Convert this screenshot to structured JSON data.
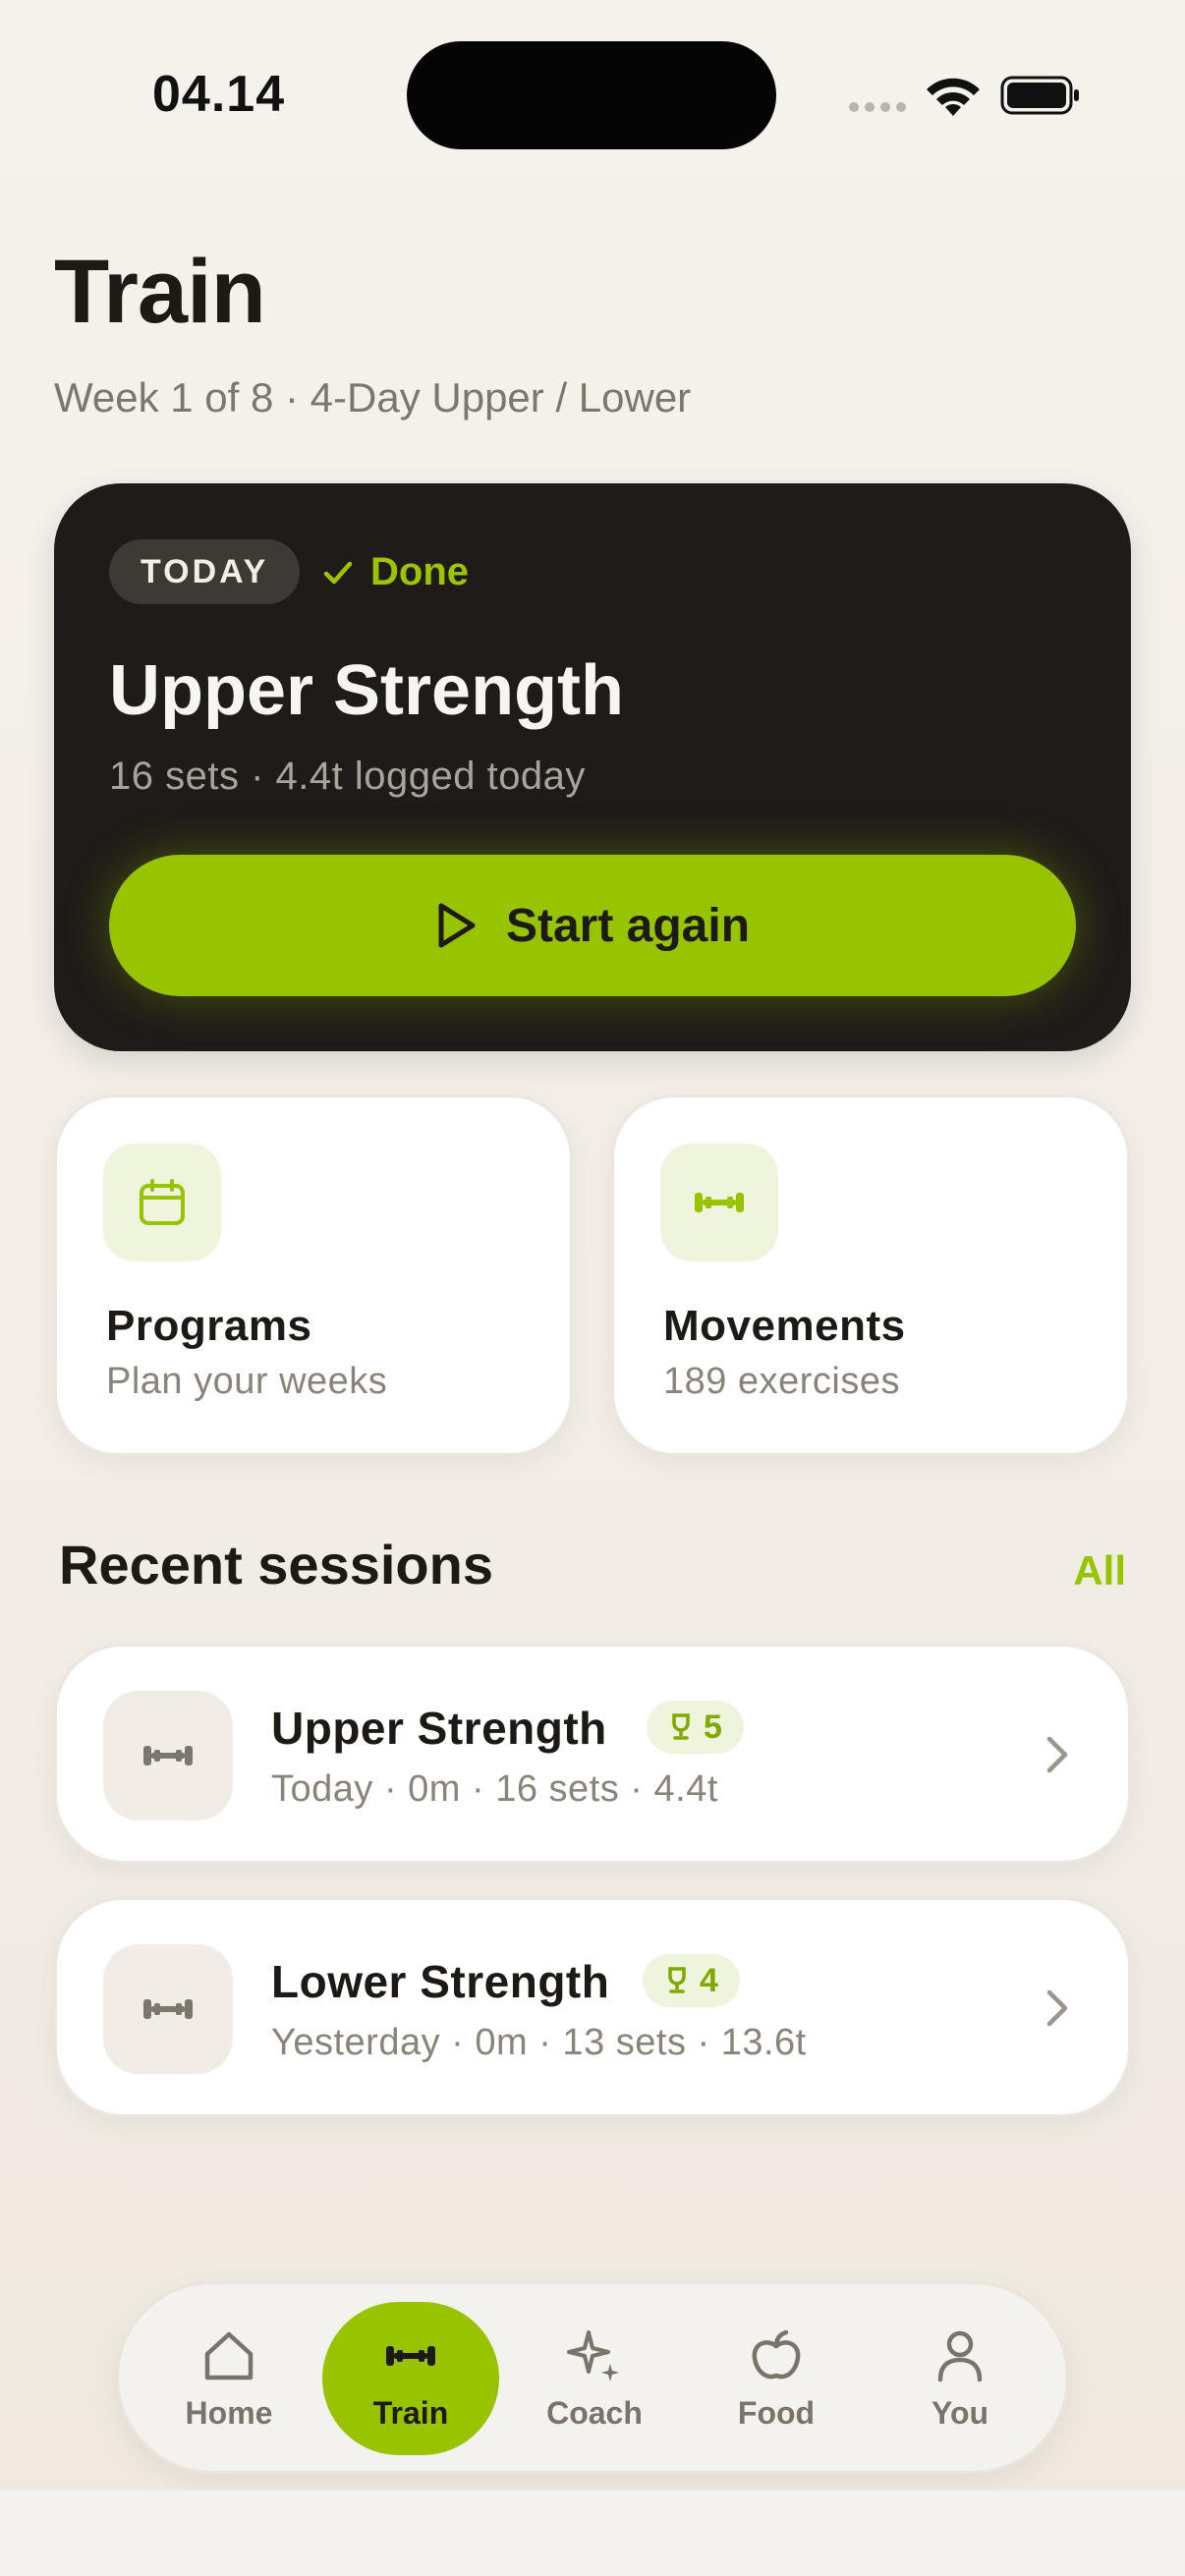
{
  "status_bar": {
    "time": "04.14"
  },
  "header": {
    "title": "Train",
    "subtitle": "Week 1 of 8 · 4-Day Upper / Lower"
  },
  "today_card": {
    "tag": "TODAY",
    "status": "Done",
    "title": "Upper Strength",
    "meta": "16 sets · 4.4t logged today",
    "button_label": "Start again"
  },
  "tiles": {
    "programs": {
      "title": "Programs",
      "subtitle": "Plan your weeks",
      "icon": "calendar-icon"
    },
    "movements": {
      "title": "Movements",
      "subtitle": "189 exercises",
      "icon": "dumbbell-icon"
    }
  },
  "recent": {
    "title": "Recent sessions",
    "link": "All",
    "sessions": [
      {
        "title": "Upper Strength",
        "pr_count": "5",
        "meta": "Today · 0m · 16 sets · 4.4t"
      },
      {
        "title": "Lower Strength",
        "pr_count": "4",
        "meta": "Yesterday · 0m · 13 sets · 13.6t"
      }
    ]
  },
  "nav": {
    "active": "Train",
    "items": [
      {
        "label": "Home",
        "icon": "home-icon"
      },
      {
        "label": "Train",
        "icon": "dumbbell-icon"
      },
      {
        "label": "Coach",
        "icon": "sparkle-icon"
      },
      {
        "label": "Food",
        "icon": "apple-icon"
      },
      {
        "label": "You",
        "icon": "person-icon"
      }
    ]
  },
  "colors": {
    "accent": "#98c300",
    "card_dark": "#1f1b18",
    "background": "#f3efe8"
  }
}
